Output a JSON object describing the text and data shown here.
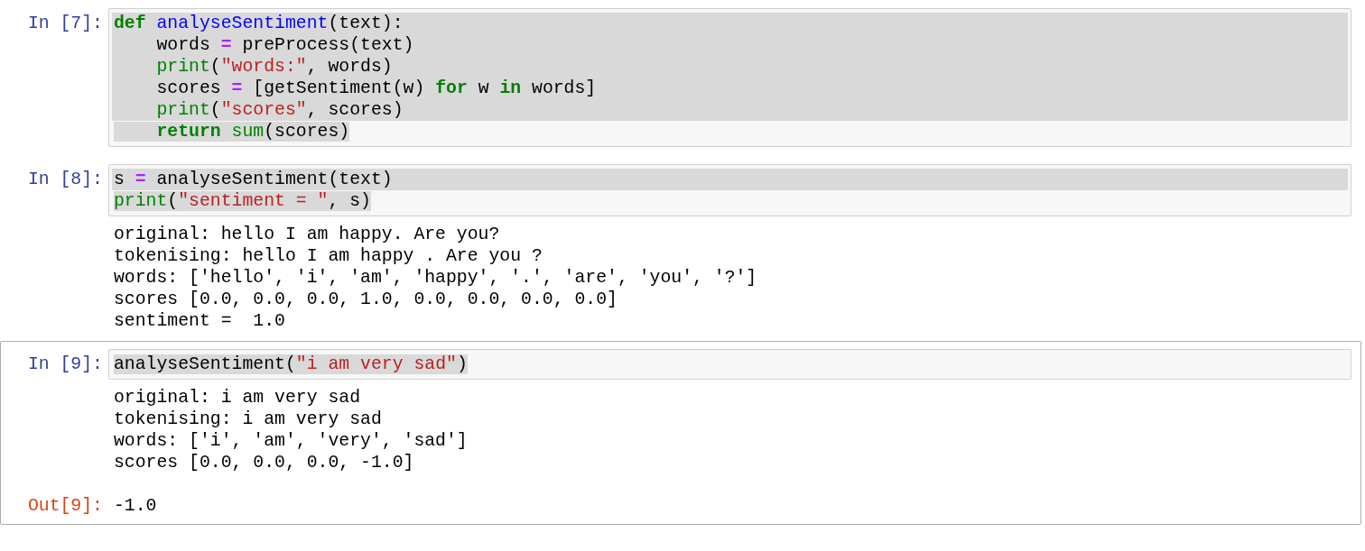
{
  "cells": [
    {
      "selected": false,
      "prompt": "In [7]:",
      "input": {
        "lines": [
          {
            "highlighted": true,
            "full_row": true,
            "tokens": [
              {
                "kind": "kw",
                "text": "def"
              },
              {
                "kind": "def",
                "text": " analyseSentiment"
              },
              {
                "kind": "plain",
                "text": "(text):"
              }
            ]
          },
          {
            "highlighted": true,
            "full_row": true,
            "tokens": [
              {
                "kind": "plain",
                "text": "    words "
              },
              {
                "kind": "op",
                "text": "="
              },
              {
                "kind": "plain",
                "text": " preProcess(text)"
              }
            ]
          },
          {
            "highlighted": true,
            "full_row": true,
            "tokens": [
              {
                "kind": "builtin",
                "text": "    print"
              },
              {
                "kind": "plain",
                "text": "("
              },
              {
                "kind": "str",
                "text": "\"words:\""
              },
              {
                "kind": "plain",
                "text": ", words)"
              }
            ]
          },
          {
            "highlighted": true,
            "full_row": true,
            "tokens": [
              {
                "kind": "plain",
                "text": "    scores "
              },
              {
                "kind": "op",
                "text": "="
              },
              {
                "kind": "plain",
                "text": " [getSentiment(w) "
              },
              {
                "kind": "kw",
                "text": "for"
              },
              {
                "kind": "plain",
                "text": " w "
              },
              {
                "kind": "kw",
                "text": "in"
              },
              {
                "kind": "plain",
                "text": " words]"
              }
            ]
          },
          {
            "highlighted": true,
            "full_row": true,
            "tokens": [
              {
                "kind": "builtin",
                "text": "    print"
              },
              {
                "kind": "plain",
                "text": "("
              },
              {
                "kind": "str",
                "text": "\"scores\""
              },
              {
                "kind": "plain",
                "text": ", scores)"
              }
            ]
          },
          {
            "highlighted": true,
            "full_row": false,
            "tokens": [
              {
                "kind": "kw",
                "text": "    return"
              },
              {
                "kind": "builtin",
                "text": " sum"
              },
              {
                "kind": "plain",
                "text": "(scores)"
              }
            ]
          }
        ]
      }
    },
    {
      "selected": false,
      "prompt": "In [8]:",
      "input": {
        "lines": [
          {
            "highlighted": true,
            "full_row": true,
            "tokens": [
              {
                "kind": "plain",
                "text": "s "
              },
              {
                "kind": "op",
                "text": "="
              },
              {
                "kind": "plain",
                "text": " analyseSentiment(text)"
              }
            ]
          },
          {
            "highlighted": true,
            "full_row": false,
            "tokens": [
              {
                "kind": "builtin",
                "text": "print"
              },
              {
                "kind": "plain",
                "text": "("
              },
              {
                "kind": "str",
                "text": "\"sentiment = \""
              },
              {
                "kind": "plain",
                "text": ", s)"
              }
            ]
          }
        ]
      },
      "outputs": [
        {
          "kind": "stream",
          "lines": [
            "original: hello I am happy. Are you?",
            "tokenising: hello I am happy . Are you ?",
            "words: ['hello', 'i', 'am', 'happy', '.', 'are', 'you', '?']",
            "scores [0.0, 0.0, 0.0, 1.0, 0.0, 0.0, 0.0, 0.0]",
            "sentiment =  1.0"
          ]
        }
      ]
    },
    {
      "selected": true,
      "prompt": "In [9]:",
      "input": {
        "lines": [
          {
            "highlighted": true,
            "full_row": false,
            "tokens": [
              {
                "kind": "plain",
                "text": "analyseSentiment("
              },
              {
                "kind": "str",
                "text": "\"i am very sad\""
              },
              {
                "kind": "plain",
                "text": ")"
              }
            ]
          }
        ]
      },
      "outputs": [
        {
          "kind": "stream",
          "lines": [
            "original: i am very sad",
            "tokenising: i am very sad",
            "words: ['i', 'am', 'very', 'sad']",
            "scores [0.0, 0.0, 0.0, -1.0]"
          ]
        },
        {
          "kind": "result",
          "prompt": "Out[9]:",
          "text": "-1.0"
        }
      ]
    }
  ]
}
